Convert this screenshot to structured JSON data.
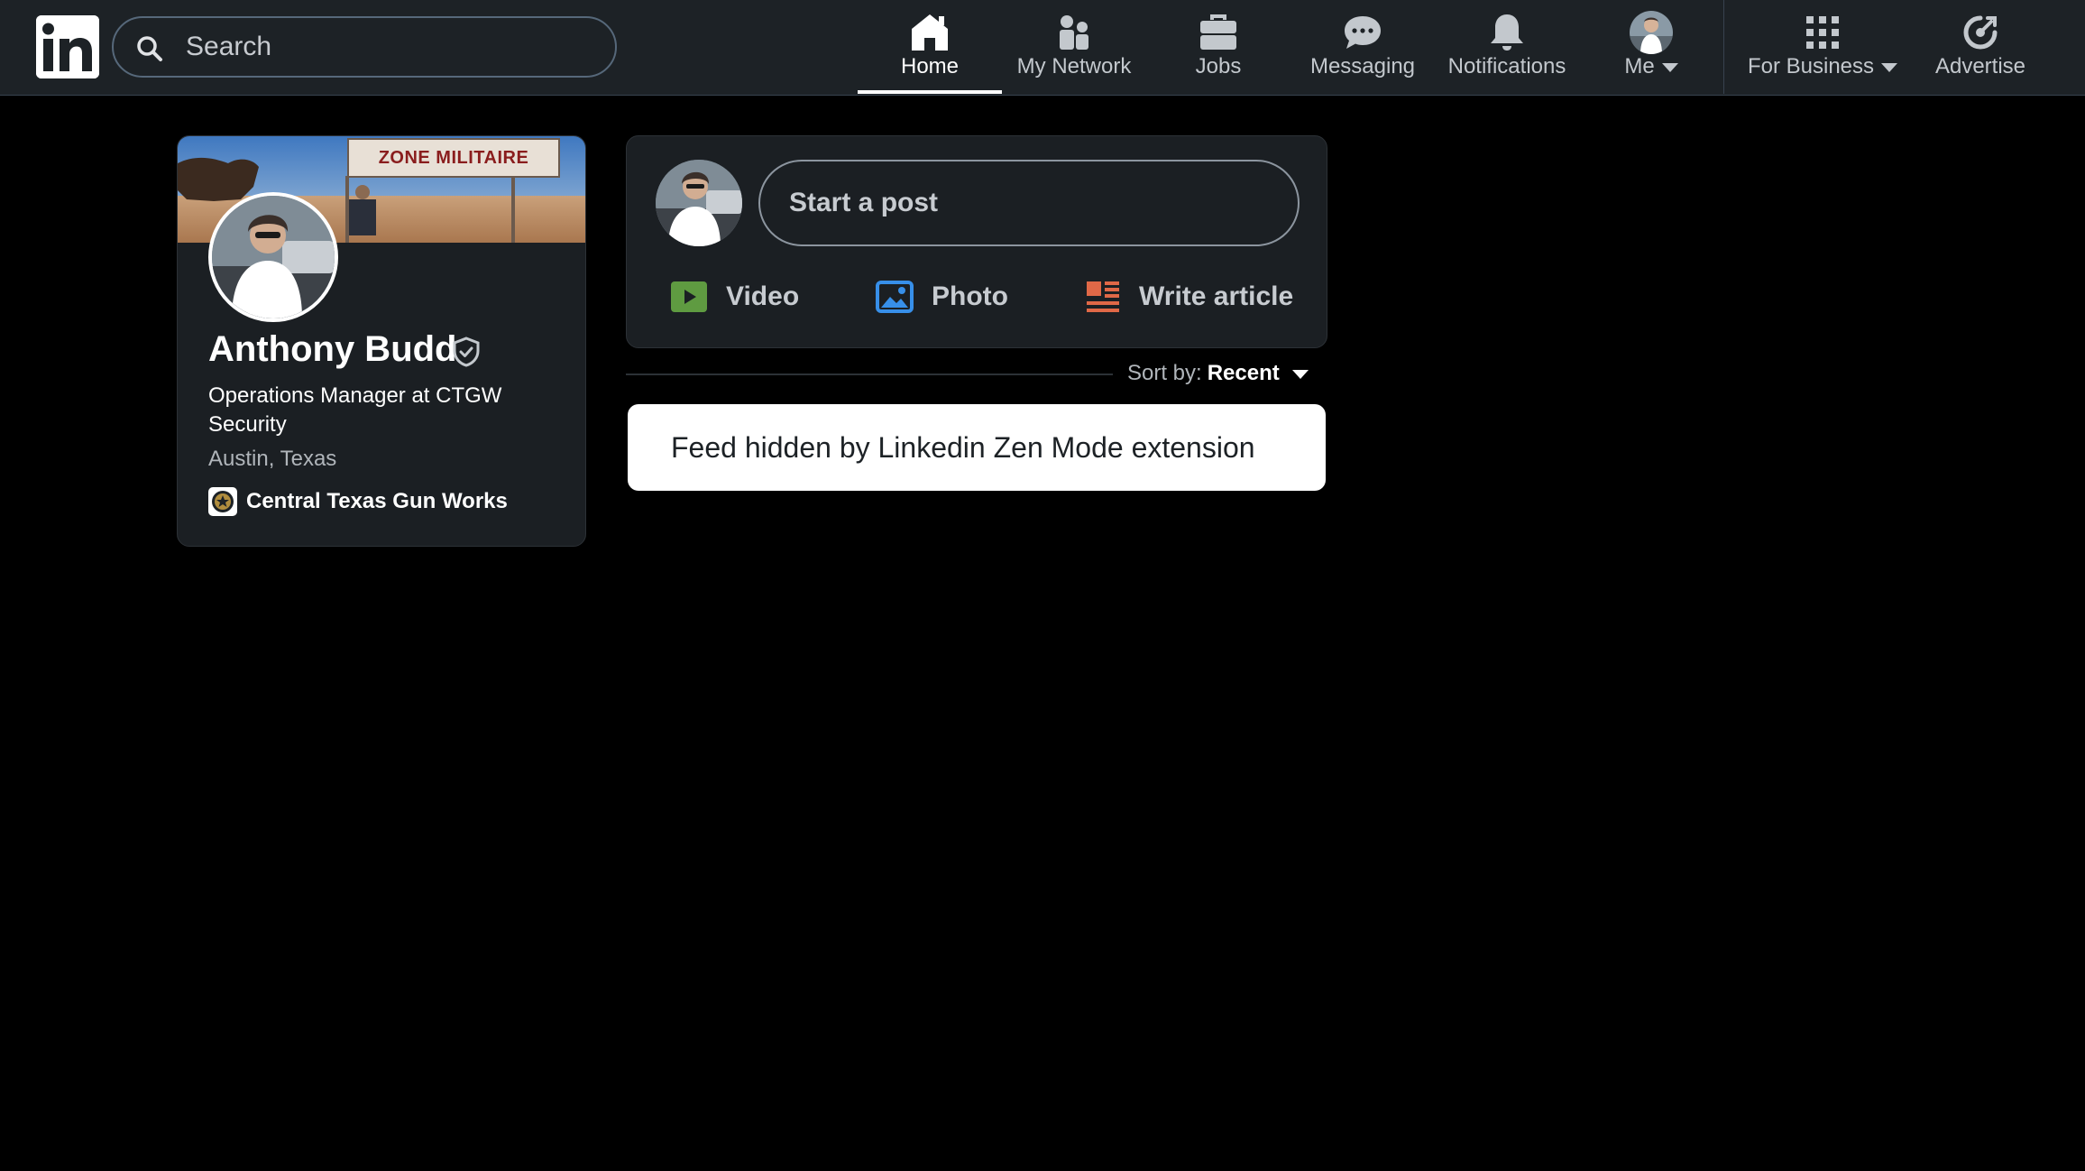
{
  "brand": {
    "logo_text": "in",
    "accent": "#0a66c2"
  },
  "search": {
    "placeholder": "Search",
    "icon": "search-icon"
  },
  "nav": {
    "items": [
      {
        "label": "Home",
        "icon": "home-icon",
        "active": true
      },
      {
        "label": "My Network",
        "icon": "network-icon"
      },
      {
        "label": "Jobs",
        "icon": "briefcase-icon"
      },
      {
        "label": "Messaging",
        "icon": "chat-icon"
      },
      {
        "label": "Notifications",
        "icon": "bell-icon"
      },
      {
        "label": "Me",
        "icon": "avatar"
      },
      {
        "label": "For Business",
        "icon": "grid-icon"
      },
      {
        "label": "Advertise",
        "icon": "advertise-icon"
      }
    ]
  },
  "profile": {
    "cover_sign": "ZONE MILITAIRE",
    "name": "Anthony Budd",
    "headline": "Operations Manager at CTGW Security",
    "location": "Austin, Texas",
    "company": "Central Texas Gun Works"
  },
  "composer": {
    "start_post": "Start a post",
    "actions": [
      {
        "label": "Video",
        "icon": "video-icon",
        "color": "#5f9b41"
      },
      {
        "label": "Photo",
        "icon": "photo-icon",
        "color": "#378fe9"
      },
      {
        "label": "Write article",
        "icon": "article-icon",
        "color": "#e06847"
      }
    ]
  },
  "sort": {
    "label": "Sort by:",
    "value": "Recent"
  },
  "feed": {
    "notice": "Feed hidden by Linkedin Zen Mode extension"
  }
}
